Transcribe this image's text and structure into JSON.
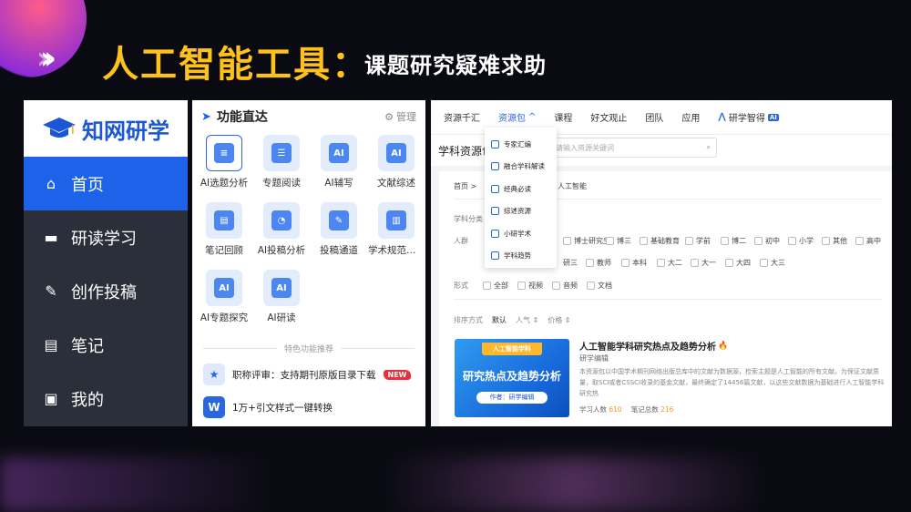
{
  "slide": {
    "title_main": "人工智能工具：",
    "title_sub": "课题研究疑难求助"
  },
  "sidebar": {
    "logo_text": "知网研学",
    "items": [
      {
        "label": "首页",
        "icon": "home-icon",
        "active": true
      },
      {
        "label": "研读学习",
        "icon": "book-icon",
        "active": false
      },
      {
        "label": "创作投稿",
        "icon": "edit-icon",
        "active": false
      },
      {
        "label": "笔记",
        "icon": "note-icon",
        "active": false
      },
      {
        "label": "我的",
        "icon": "user-icon",
        "active": false
      }
    ],
    "colors": {
      "active": "#1d63ea",
      "background": "#2b2f3a",
      "logo": "#1a56d6"
    }
  },
  "functions": {
    "title": "功能直达",
    "manage_label": "管理",
    "items": [
      {
        "label": "AI选题分析",
        "icon": "topic-analysis-icon",
        "glyph": "≡"
      },
      {
        "label": "专题阅读",
        "icon": "reading-icon",
        "glyph": "☰"
      },
      {
        "label": "AI辅写",
        "icon": "ai-write-icon",
        "glyph": "AI"
      },
      {
        "label": "文献综述",
        "icon": "review-icon",
        "glyph": "AI"
      },
      {
        "label": "笔记回顾",
        "icon": "notes-review-icon",
        "glyph": "▤"
      },
      {
        "label": "AI投稿分析",
        "icon": "pie-chart-icon",
        "glyph": "◔"
      },
      {
        "label": "投稿通道",
        "icon": "submit-icon",
        "glyph": "✎"
      },
      {
        "label": "学术规范检测",
        "icon": "norm-check-icon",
        "glyph": "▥"
      },
      {
        "label": "AI专题探究",
        "icon": "ai-explore-icon",
        "glyph": "AI"
      },
      {
        "label": "AI研读",
        "icon": "ai-study-icon",
        "glyph": "AI"
      }
    ],
    "featured_label": "特色功能推荐",
    "featured": [
      {
        "text": "职称评审：支持期刊原版目录下载",
        "badge": "NEW",
        "icon": "medal-icon",
        "glyph": "★"
      },
      {
        "text": "1万+引文样式一键转换",
        "badge": "",
        "icon": "word-icon",
        "glyph": "W"
      }
    ]
  },
  "web": {
    "nav": [
      {
        "label": "资源千汇",
        "active": false
      },
      {
        "label": "资源包",
        "active": true,
        "chevron": "^"
      },
      {
        "label": "课程",
        "active": false
      },
      {
        "label": "好文观止",
        "active": false
      },
      {
        "label": "团队",
        "active": false
      },
      {
        "label": "应用",
        "active": false
      },
      {
        "label": "研学智得",
        "active": false,
        "badge": "AI"
      }
    ],
    "subtitle": "学科资源包",
    "search_placeholder": "请输入资源关键词",
    "breadcrumb": "首页 >",
    "breadcrumb_tail": "人工智能",
    "dropdown": [
      "专家汇编",
      "融合学科解读",
      "经典必读",
      "综述资源",
      "小研学术",
      "学科趋势"
    ],
    "filters": {
      "category_label": "学科分类",
      "people_label": "人群",
      "people_options": [
        "博士研究生",
        "博三",
        "基础教育",
        "学前",
        "博二",
        "初中",
        "小学",
        "其他",
        "高中"
      ],
      "people_row2": [
        "研三",
        "教师",
        "本科",
        "大二",
        "大一",
        "大四",
        "大三"
      ],
      "form_label": "形式",
      "form_options": [
        "全部",
        "视频",
        "音频",
        "文档"
      ],
      "sort_label": "排序方式",
      "sort_options": [
        "默认",
        "人气 ⇕",
        "价格 ⇕"
      ]
    },
    "card": {
      "img_top": "人工智能学科",
      "img_main": "研究热点及趋势分析",
      "img_author": "作者：研学编辑",
      "title": "人工智能学科研究热点及趋势分析",
      "hot_icon": "🔥",
      "author": "研学编辑",
      "desc": "本资源包以中国学术期刊网络出版总库中的文献为数据源，检索主题是人工智能的所有文献。为保证文献质量，取SCI或者CSSCI收录的基金文献，最终确定了14456篇文献，以这些文献数据为基础进行人工智能学科研究热",
      "learners_label": "学习人数",
      "learners": "610",
      "notes_label": "笔记总数",
      "notes": "216"
    }
  }
}
